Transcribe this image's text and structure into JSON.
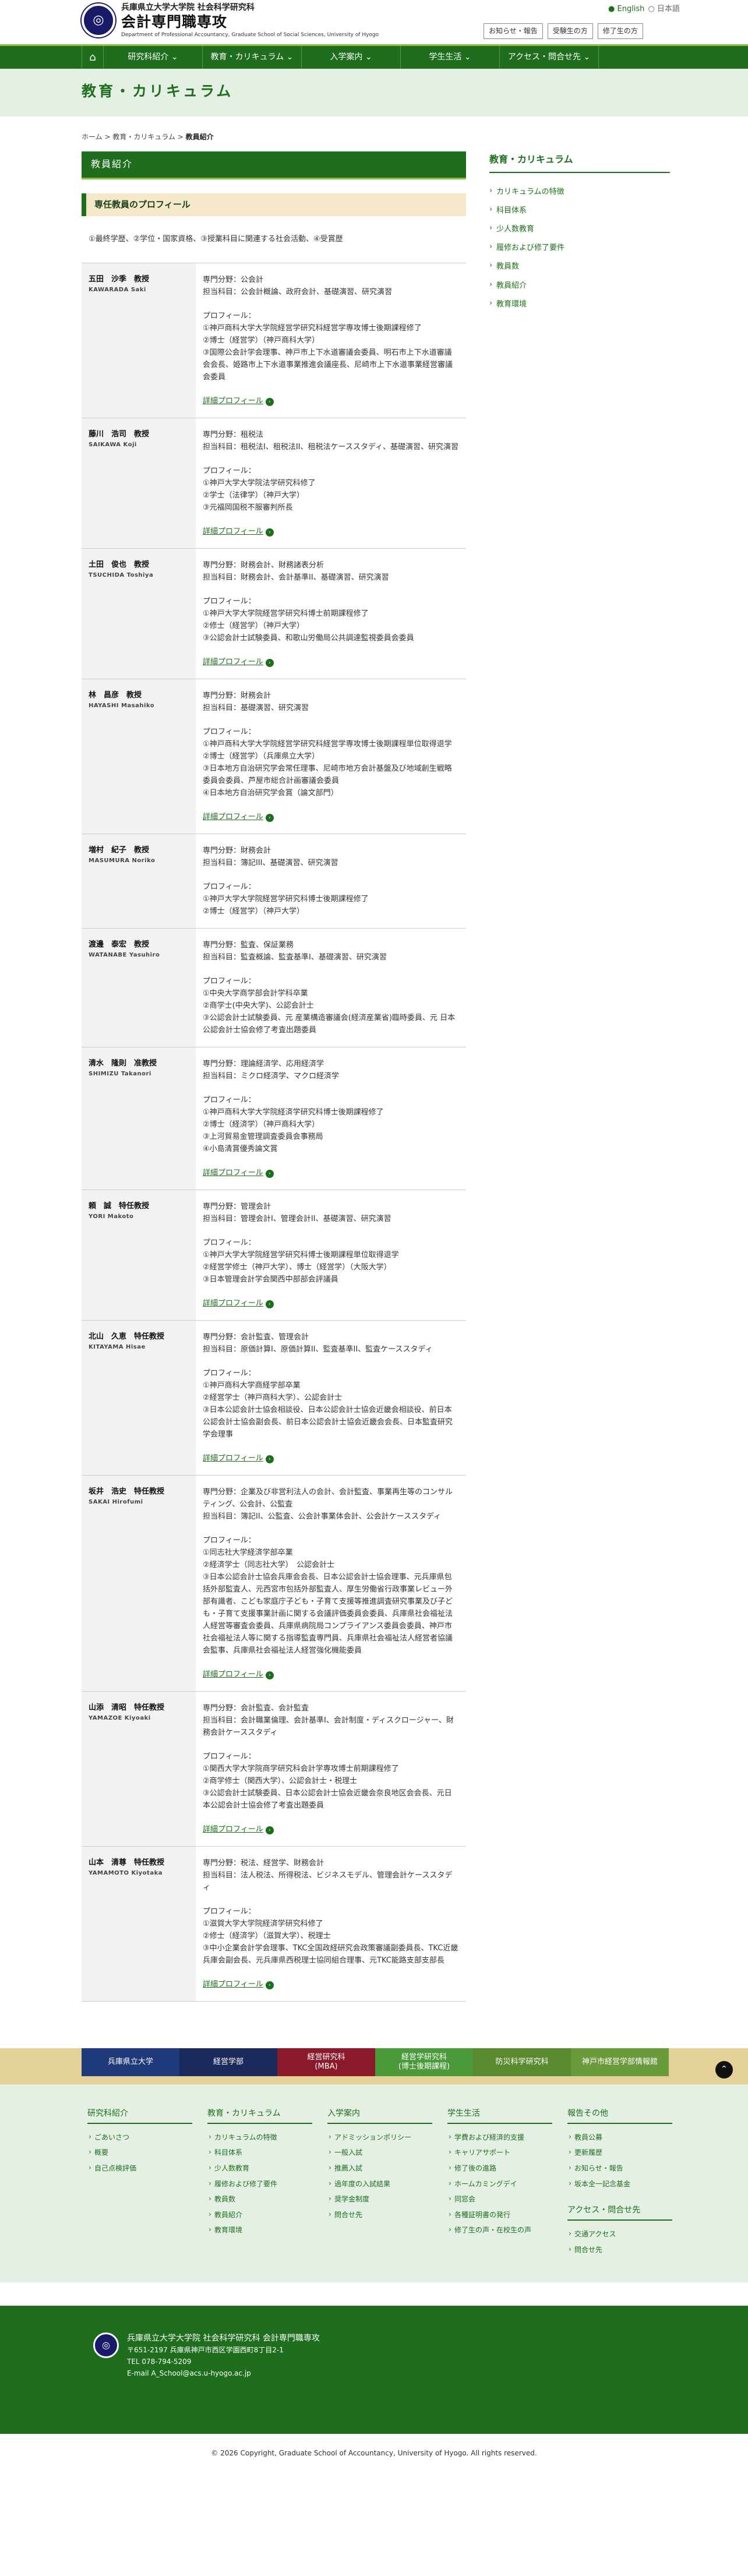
{
  "header": {
    "univ": "兵庫県立大学大学院 社会科学研究科",
    "dept": "会計専門職専攻",
    "dept_en": "Department of Professional Accountancy, Graduate School of Social Sciences, University of Hyogo",
    "lang_en": "English",
    "lang_jp": "日本語",
    "subnav": [
      "お知らせ・報告",
      "受験生の方",
      "修了生の方"
    ]
  },
  "gnav": {
    "home": "⌂",
    "items": [
      "研究科紹介 ⌄",
      "教育・カリキュラム ⌄",
      "入学案内 ⌄",
      "学生生活 ⌄",
      "アクセス・問合せ先 ⌄"
    ]
  },
  "banner": {
    "title": "教育・カリキュラム"
  },
  "breadcrumb": {
    "home": "ホーム",
    "sep1": " > ",
    "mid": "教育・カリキュラム",
    "sep2": " > ",
    "current": "教員紹介"
  },
  "section": {
    "title": "教員紹介",
    "subtitle": "専任教員のプロフィール",
    "legend": "①最終学歴、②学位・国家資格、③授業科目に関連する社会活動、④受賞歴"
  },
  "more_label": "詳細プロフィール",
  "faculty": [
    {
      "jp": "五田　沙季　教授",
      "en": "KAWARADA Saki",
      "spec": "専門分野：公会計",
      "course": "担当科目：公会計概論、政府会計、基礎演習、研究演習",
      "lines": [
        "①神戸商科大学大学院経営学研究科経営学専攻博士後期課程修了",
        "②博士（経営学）（神戸商科大学）",
        "③国際公会計学会理事、神戸市上下水道審議会委員、明石市上下水道審議会会長、姫路市上下水道事業推進会議座長、尼崎市上下水道事業経営審議会委員"
      ],
      "more": true
    },
    {
      "jp": "藤川　浩司　教授",
      "en": "SAIKAWA Koji",
      "spec": "専門分野：租税法",
      "course": "担当科目：租税法I、租税法II、租税法ケーススタディ、基礎演習、研究演習",
      "lines": [
        "①神戸大学大学院法学研究科修了",
        "②学士（法律学）（神戸大学）",
        "③元福岡国税不服審判所長"
      ],
      "more": true
    },
    {
      "jp": "土田　俊也　教授",
      "en": "TSUCHIDA Toshiya",
      "spec": "専門分野：財務会計、財務諸表分析",
      "course": "担当科目：財務会計、会計基準II、基礎演習、研究演習",
      "lines": [
        "①神戸大学大学院経営学研究科博士前期課程修了",
        "②修士（経営学）（神戸大学）",
        "③公認会計士試験委員、和歌山労働局公共調達監視委員会委員"
      ],
      "more": true
    },
    {
      "jp": "林　昌彦　教授",
      "en": "HAYASHI Masahiko",
      "spec": "専門分野：財務会計",
      "course": "担当科目：基礎演習、研究演習",
      "lines": [
        "①神戸商科大学大学院経営学研究科経営学専攻博士後期課程単位取得退学",
        "②博士（経営学）（兵庫県立大学）",
        "③日本地方自治研究学会常任理事、尼崎市地方会計基盤及び地域創生戦略委員会委員、芦屋市総合計画審議会委員",
        "④日本地方自治研究学会賞（論文部門）"
      ],
      "more": true
    },
    {
      "jp": "増村　紀子　教授",
      "en": "MASUMURA Noriko",
      "spec": "専門分野：財務会計",
      "course": "担当科目：簿記III、基礎演習、研究演習",
      "lines": [
        "①神戸大学大学院経営学研究科博士後期課程修了",
        "②博士（経営学）（神戸大学）"
      ],
      "more": false
    },
    {
      "jp": "渡邊　泰宏　教授",
      "en": "WATANABE Yasuhiro",
      "spec": "専門分野：監査、保証業務",
      "course": "担当科目：監査概論、監査基準I、基礎演習、研究演習",
      "lines": [
        "①中央大学商学部会計学科卒業",
        "②商学士(中央大学)、公認会計士",
        "③公認会計士試験委員、元 産業構造審議会(経済産業省)臨時委員、元 日本公認会計士協会修了考査出題委員"
      ],
      "more": false
    },
    {
      "jp": "清水　隆則　准教授",
      "en": "SHIMIZU Takanori",
      "spec": "専門分野：理論経済学、応用経済学",
      "course": "担当科目：ミクロ経済学、マクロ経済学",
      "lines": [
        "①神戸商科大学大学院経済学研究科博士後期課程修了",
        "②博士（経済学）（神戸商科大学）",
        "③上河貿易金管理調査委員会事務局",
        "④小島清賞優秀論文賞"
      ],
      "more": true
    },
    {
      "jp": "頼　誠　特任教授",
      "en": "YORI Makoto",
      "spec": "専門分野：管理会計",
      "course": "担当科目：管理会計I、管理会計II、基礎演習、研究演習",
      "lines": [
        "①神戸大学大学院経営学研究科博士後期課程単位取得退学",
        "②経営学修士（神戸大学）、博士（経営学）（大阪大学）",
        "③日本管理会計学会関西中部部会評議員"
      ],
      "more": true
    },
    {
      "jp": "北山　久恵　特任教授",
      "en": "KITAYAMA Hisae",
      "spec": "専門分野：会計監査、管理会計",
      "course": "担当科目：原価計算I、原価計算II、監査基準II、監査ケーススタディ",
      "lines": [
        "①神戸商科大学商経学部卒業",
        "②経営学士（神戸商科大学）、公認会計士",
        "③日本公認会計士協会相談役、日本公認会計士協会近畿会相談役、前日本公認会計士協会副会長、前日本公認会計士協会近畿会会長、日本監査研究学会理事"
      ],
      "more": true
    },
    {
      "jp": "坂井　浩史　特任教授",
      "en": "SAKAI Hirofumi",
      "spec": "専門分野：企業及び非営利法人の会計、会計監査、事業再生等のコンサルティング、公会計、公監査",
      "course": "担当科目：簿記II、公監査、公会計事業体会計、公会計ケーススタディ",
      "lines": [
        "①同志社大学経済学部卒業",
        "②経済学士（同志社大学）　公認会計士",
        "③日本公認会計士協会兵庫会会長、日本公認会計士協会理事、元兵庫県包括外部監査人、元西宮市包括外部監査人、厚生労働省行政事業レビュー外部有識者、こども家庭庁子ども・子育て支援等推進調査研究事業及び子ども・子育て支援事業計画に関する会議評価委員会委員、兵庫県社会福祉法人経営等審査会委員、兵庫県病院局コンプライアンス委員会委員、神戸市社会福祉法人等に関する指導監査専門員、兵庫県社会福祉法人経営者協議会監事、兵庫県社会福祉法人経営強化機能委員"
      ],
      "more": true
    },
    {
      "jp": "山添　清昭　特任教授",
      "en": "YAMAZOE Kiyoaki",
      "spec": "専門分野：会計監査、会計監査",
      "course": "担当科目：会計職業倫理、会計基準I、会計制度・ディスクロージャー、財務会計ケーススタディ",
      "lines": [
        "①関西大学大学院商学研究科会計学専攻博士前期課程修了",
        "②商学修士（関西大学）、公認会計士・税理士",
        "③公認会計士試験委員、日本公認会計士協会近畿会奈良地区会会長、元日本公認会計士協会修了考査出題委員"
      ],
      "more": true
    },
    {
      "jp": "山本　清尊　特任教授",
      "en": "YAMAMOTO Kiyotaka",
      "spec": "専門分野：税法、経営学、財務会計",
      "course": "担当科目：法人税法、所得税法、ビジネスモデル、管理会計ケーススタディ",
      "lines": [
        "①滋賀大学大学院経済学研究科修了",
        "②修士（経済学）（滋賀大学）、税理士",
        "③中小企業会計学会理事、TKC全国政経研究会政策審議副委員長、TKC近畿兵庫会副会長、元兵庫県西税理士協同組合理事、元TKC能路支部支部長"
      ],
      "more": true
    }
  ],
  "side": {
    "title": "教育・カリキュラム",
    "items": [
      "カリキュラムの特徴",
      "科目体系",
      "少人数教育",
      "履修および修了要件",
      "教員数",
      "教員紹介",
      "教育環境"
    ]
  },
  "footer_tabs": [
    {
      "label": "兵庫県立大学",
      "color": "#1f3a7a"
    },
    {
      "label": "経営学部",
      "color": "#1a2a5a"
    },
    {
      "label": "経営研究科\n(MBA)",
      "color": "#8a1a2a"
    },
    {
      "label": "経営学研究科\n(博士後期課程)",
      "color": "#4a9a3a"
    },
    {
      "label": "防災科学研究科",
      "color": "#5a8a30"
    },
    {
      "label": "神戸市経営学部情報館",
      "color": "#6a9a3a"
    }
  ],
  "page_top": "⌃",
  "footer_menu": [
    {
      "title": "研究科紹介",
      "items": [
        "ごあいさつ",
        "概要",
        "自己点検評価"
      ]
    },
    {
      "title": "教育・カリキュラム",
      "items": [
        "カリキュラムの特徴",
        "科目体系",
        "少人数教育",
        "履修および修了要件",
        "教員数",
        "教員紹介",
        "教育環境"
      ]
    },
    {
      "title": "入学案内",
      "items": [
        "アドミッションポリシー",
        "一般入試",
        "推薦入試",
        "過年度の入試結果",
        "奨学金制度",
        "問合せ先"
      ]
    },
    {
      "title": "学生生活",
      "items": [
        "学費および経済的支援",
        "キャリアサポート",
        "修了後の進路",
        "ホームカミングデイ",
        "同窓会",
        "各種証明書の発行",
        "修了生の声・在校生の声"
      ]
    },
    {
      "title": "報告その他",
      "items": [
        "教員公募",
        "更新履歴",
        "お知らせ・報告",
        "坂本全一記念基金"
      ],
      "sub_title": "アクセス・問合せ先",
      "sub_items": [
        "交通アクセス",
        "問合せ先"
      ]
    }
  ],
  "footer": {
    "name": "兵庫県立大学大学院 社会科学研究科 会計専門職専攻",
    "addr": "〒651-2197 兵庫県神戸市西区学園西町8丁目2-1",
    "tel": "TEL 078-794-5209",
    "mail": "E-mail A_School@acs.u-hyogo.ac.jp",
    "copyright": "© 2026 Copyright, Graduate School of Accountancy, University of Hyogo. All rights reserved."
  }
}
